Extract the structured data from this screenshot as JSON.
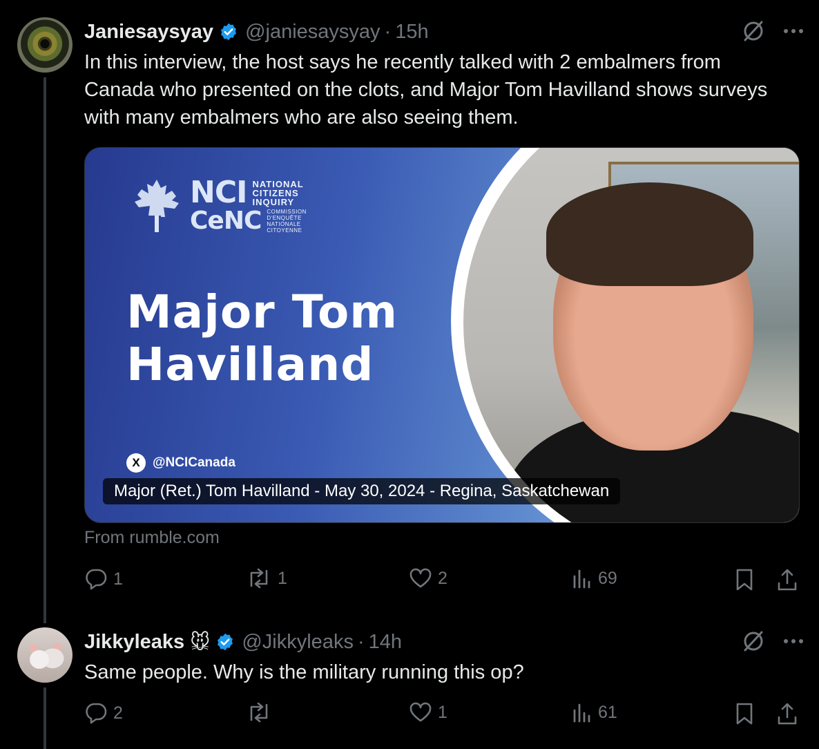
{
  "tweets": [
    {
      "name": "Janiesaysyay",
      "handle": "@janiesaysyay",
      "dot": "·",
      "time": "15h",
      "text": "In this interview, the host says he recently talked with 2 embalmers from Canada who presented on the clots, and Major Tom Havilland shows surveys with many embalmers who are also seeing them.",
      "card": {
        "logo_nci": "NCI",
        "logo_national": "NATIONAL",
        "logo_citizens": "CITIZENS",
        "logo_inquiry": "INQUIRY",
        "logo_cenc": "CeNC",
        "logo_commission": "COMMISSION",
        "logo_denquete": "D'ENQUÊTE",
        "logo_nationale": "NATIONALE",
        "logo_citoyenne": "CITOYENNE",
        "title_line1": "Major Tom",
        "title_line2": "Havilland",
        "social_icon": "X",
        "social_handle": "@NCICanada",
        "caption": "Major (Ret.) Tom Havilland - May 30, 2024 - Regina, Saskatchewan"
      },
      "source": "From rumble.com",
      "replies": "1",
      "reposts": "1",
      "likes": "2",
      "views": "69"
    },
    {
      "name": "Jikkyleaks",
      "emoji": "🐭",
      "handle": "@Jikkyleaks",
      "dot": "·",
      "time": "14h",
      "text": "Same people. Why is the military running this op?",
      "replies": "2",
      "reposts": "",
      "likes": "1",
      "views": "61"
    }
  ],
  "colors": {
    "background": "#000000",
    "text": "#e7e9ea",
    "muted": "#71767b",
    "verified": "#1d9bf0",
    "thread_line": "#333639"
  }
}
